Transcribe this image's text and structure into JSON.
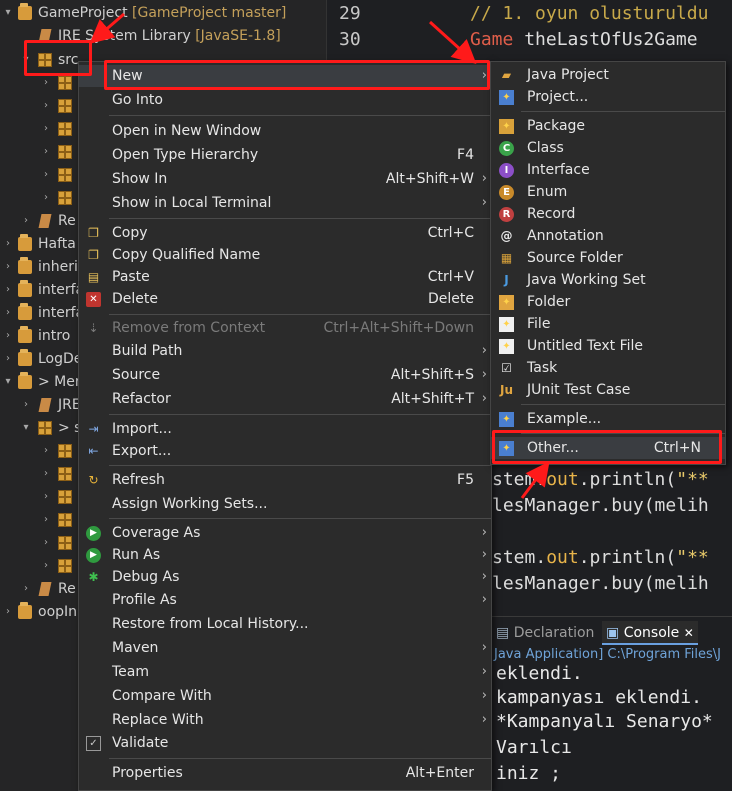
{
  "explorer": {
    "rows": [
      {
        "label": "GameProject",
        "deco": "[GameProject master]"
      },
      {
        "label": "JRE System Library",
        "deco": "[JavaSE-1.8]"
      },
      {
        "label": "src"
      },
      {
        "label": "Re"
      },
      {
        "label": "Hafta"
      },
      {
        "label": "inheri"
      },
      {
        "label": "interfa"
      },
      {
        "label": "interfa"
      },
      {
        "label": "intro"
      },
      {
        "label": "LogDe"
      },
      {
        "label": "> Mer"
      },
      {
        "label": "JRE"
      },
      {
        "label": "> s"
      },
      {
        "label": "Re"
      },
      {
        "label": "oopIn"
      }
    ]
  },
  "editor": {
    "line_numbers": [
      "29",
      "30"
    ],
    "comment": "// 1. oyun olusturuldu",
    "type_name": "Game",
    "var_name": "theLastOfUs2Game",
    "snip_system": "stem.",
    "snip_out": "out",
    "snip_println": ".println(",
    "snip_str": "\"**",
    "snip_sales": "lesManager.buy(melih"
  },
  "console": {
    "tab_declaration": "Declaration",
    "tab_console": "Console",
    "tab_close": "✕",
    "path": "Java Application] C:\\Program Files\\J",
    "lines": [
      "eklendi.",
      "kampanyası eklendi.",
      "*Kampanyalı Senaryo*",
      "Varılcı",
      "iniz ;"
    ]
  },
  "context_menu": {
    "new": {
      "label": "New"
    },
    "go_into": {
      "label": "Go Into"
    },
    "open_new_window": {
      "label": "Open in New Window"
    },
    "open_type_hierarchy": {
      "label": "Open Type Hierarchy",
      "shortcut": "F4"
    },
    "show_in": {
      "label": "Show In",
      "shortcut": "Alt+Shift+W"
    },
    "show_terminal": {
      "label": "Show in Local Terminal"
    },
    "copy": {
      "label": "Copy",
      "shortcut": "Ctrl+C"
    },
    "copy_qualified": {
      "label": "Copy Qualified Name"
    },
    "paste": {
      "label": "Paste",
      "shortcut": "Ctrl+V"
    },
    "delete": {
      "label": "Delete",
      "shortcut": "Delete"
    },
    "remove_context": {
      "label": "Remove from Context",
      "shortcut": "Ctrl+Alt+Shift+Down"
    },
    "build_path": {
      "label": "Build Path"
    },
    "source": {
      "label": "Source",
      "shortcut": "Alt+Shift+S"
    },
    "refactor": {
      "label": "Refactor",
      "shortcut": "Alt+Shift+T"
    },
    "import": {
      "label": "Import..."
    },
    "export": {
      "label": "Export..."
    },
    "refresh": {
      "label": "Refresh",
      "shortcut": "F5"
    },
    "assign_working_sets": {
      "label": "Assign Working Sets..."
    },
    "coverage_as": {
      "label": "Coverage As"
    },
    "run_as": {
      "label": "Run As"
    },
    "debug_as": {
      "label": "Debug As"
    },
    "profile_as": {
      "label": "Profile As"
    },
    "restore_history": {
      "label": "Restore from Local History..."
    },
    "maven": {
      "label": "Maven"
    },
    "team": {
      "label": "Team"
    },
    "compare_with": {
      "label": "Compare With"
    },
    "replace_with": {
      "label": "Replace With"
    },
    "validate": {
      "label": "Validate"
    },
    "properties": {
      "label": "Properties",
      "shortcut": "Alt+Enter"
    }
  },
  "submenu_new": {
    "java_project": "Java Project",
    "project": "Project...",
    "package": "Package",
    "class": "Class",
    "interface": "Interface",
    "enum": "Enum",
    "record": "Record",
    "annotation": "Annotation",
    "source_folder": "Source Folder",
    "java_working_set": "Java Working Set",
    "folder": "Folder",
    "file": "File",
    "untitled_text_file": "Untitled Text File",
    "task": "Task",
    "junit_test_case": "JUnit Test Case",
    "example": "Example...",
    "other": "Other...",
    "other_shortcut": "Ctrl+N"
  },
  "colors": {
    "highlight_box": "#ff1a1a",
    "menu_bg": "#2b2b2b",
    "explorer_bg": "#252526"
  }
}
